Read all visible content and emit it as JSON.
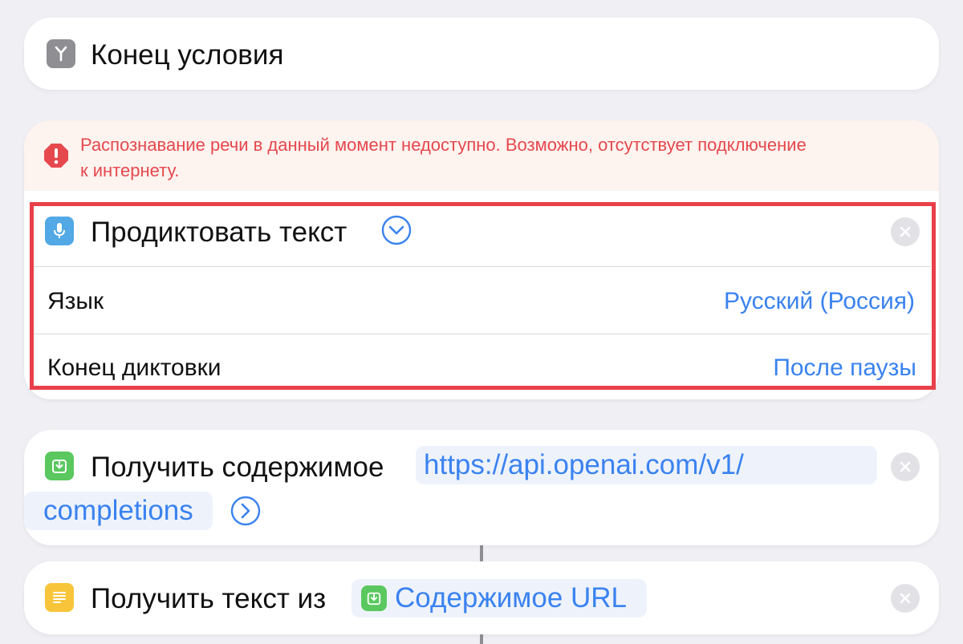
{
  "end_condition": {
    "title": "Конец условия"
  },
  "dictate": {
    "error_message_line1": "Распознавание речи в данный момент недоступно. Возможно, отсутствует подключение",
    "error_message_line2": "к интернету.",
    "title": "Продиктовать текст",
    "language_label": "Язык",
    "language_value": "Русский (Россия)",
    "end_label": "Конец диктовки",
    "end_value": "После паузы"
  },
  "get_contents": {
    "title": "Получить содержимое",
    "url_part1": "https://api.openai.com/v1/",
    "url_part2": "completions"
  },
  "get_text": {
    "title": "Получить текст из",
    "source": "Содержимое URL"
  },
  "colors": {
    "accent_blue": "#3a82f0",
    "error_red": "#e5484d",
    "highlight_border": "#e8404a",
    "green_tile": "#5ac85f",
    "yellow_tile": "#f8c53a",
    "gray_tile": "#8e8e93",
    "mic_tile": "#52a9e6"
  }
}
